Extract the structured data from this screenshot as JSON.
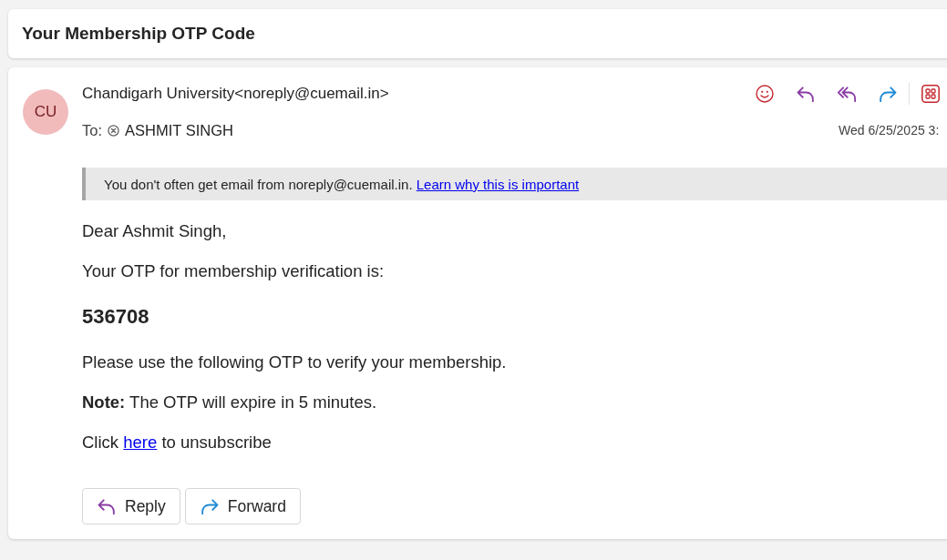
{
  "subject": "Your Membership OTP Code",
  "message": {
    "avatar_initials": "CU",
    "from": "Chandigarh University<noreply@cuemail.in>",
    "to_label": "To:",
    "recipients": [
      {
        "name": "ASHMIT SINGH"
      }
    ],
    "date": "Wed 6/25/2025 3:",
    "notice": {
      "text": "You don't often get email from noreply@cuemail.in.",
      "link": "Learn why this is important"
    },
    "body": [
      {
        "kind": "text",
        "text": "Dear Ashmit Singh,"
      },
      {
        "kind": "text",
        "text": "Your OTP for membership verification is:"
      },
      {
        "kind": "code",
        "text": "536708"
      },
      {
        "kind": "text",
        "text": "Please use the following OTP to verify your membership."
      },
      {
        "kind": "text",
        "text": "**Note:** The OTP will expire in 5 minutes."
      },
      {
        "kind": "link_line",
        "before": "Click",
        "link": "here",
        "after": "to unsubscribe"
      }
    ],
    "buttons": [
      {
        "kind": "reply",
        "label": "Reply"
      },
      {
        "kind": "forward",
        "label": "Forward"
      }
    ]
  }
}
